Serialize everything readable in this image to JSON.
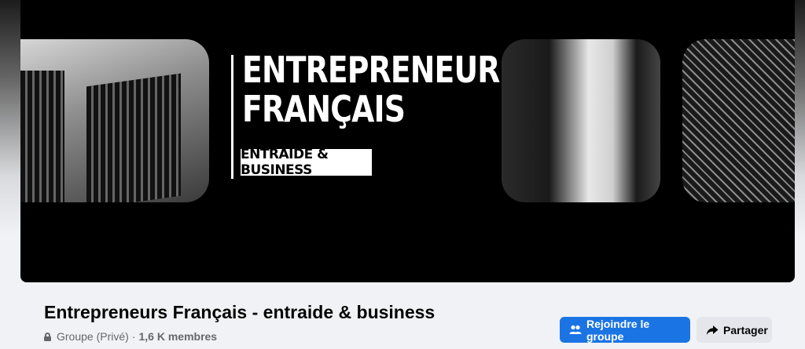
{
  "cover": {
    "title_line1": "ENTREPRENEURS",
    "title_line2": "FRANÇAIS",
    "tagline": "ENTRAIDE & BUSINESS"
  },
  "group": {
    "name": "Entrepreneurs Français - entraide & business",
    "privacy": "Groupe (Privé)",
    "separator": "·",
    "members": "1,6 K membres"
  },
  "actions": {
    "join_label": "Rejoindre le groupe",
    "share_label": "Partager"
  },
  "colors": {
    "primary": "#1b74e4",
    "secondary_button": "#e4e6eb",
    "cover_background": "#000000"
  },
  "icons": [
    "lock-icon",
    "people-icon",
    "share-arrow-icon"
  ]
}
